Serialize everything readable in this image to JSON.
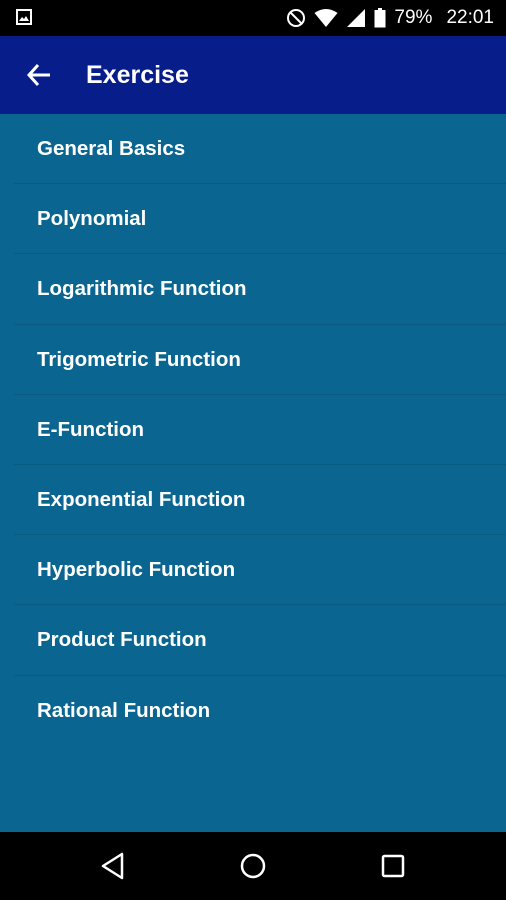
{
  "status_bar": {
    "battery": "79%",
    "time": "22:01",
    "icons": [
      "image-icon",
      "do-not-disturb-icon",
      "wifi-icon",
      "signal-icon",
      "battery-icon"
    ]
  },
  "app_bar": {
    "title": "Exercise",
    "back_icon": "arrow-back-icon"
  },
  "list": {
    "items": [
      {
        "label": "General Basics"
      },
      {
        "label": "Polynomial"
      },
      {
        "label": "Logarithmic Function"
      },
      {
        "label": "Trigometric Function"
      },
      {
        "label": "E-Function"
      },
      {
        "label": "Exponential Function"
      },
      {
        "label": "Hyperbolic Function"
      },
      {
        "label": "Product Function"
      },
      {
        "label": "Rational Function"
      }
    ]
  },
  "nav_bar": {
    "icons": [
      "back-triangle-icon",
      "home-circle-icon",
      "recents-square-icon"
    ]
  },
  "colors": {
    "status_bar": "#000000",
    "app_bar": "#061d8a",
    "list_background": "#0a6690",
    "divider": "#0b5b80",
    "text": "#ffffff"
  }
}
